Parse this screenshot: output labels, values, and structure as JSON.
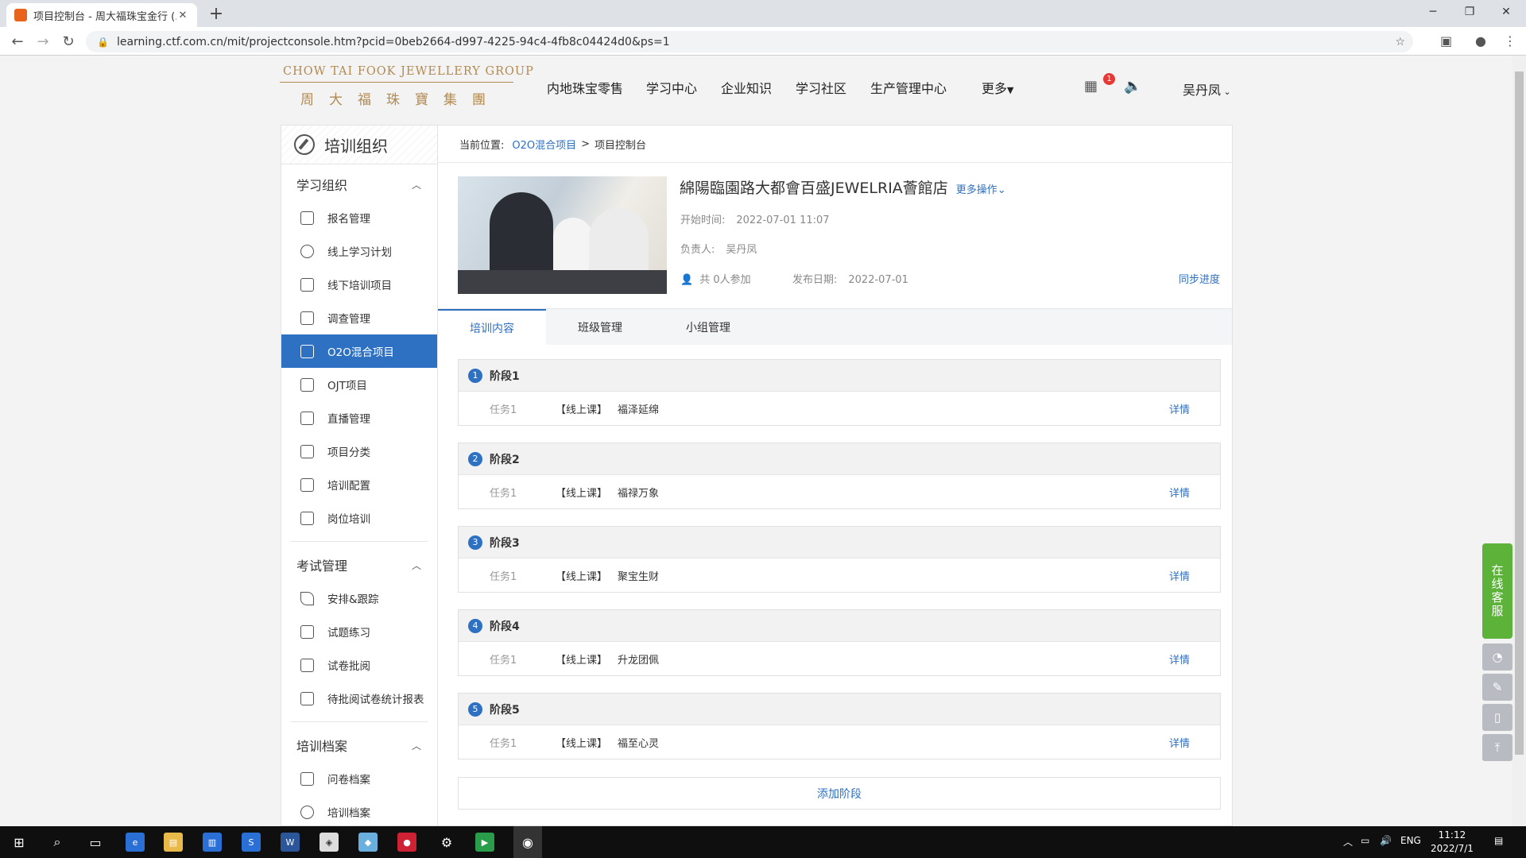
{
  "browser": {
    "tab_title": "项目控制台 - 周大福珠宝金行 (...",
    "url": "learning.ctf.com.cn/mit/projectconsole.htm?pcid=0beb2664-d997-4225-94c4-4fb8c04424d0&ps=1"
  },
  "site": {
    "logo_en": "CHOW TAI FOOK JEWELLERY GROUP",
    "logo_cn": "周大福珠寶集團",
    "nav": [
      "内地珠宝零售",
      "学习中心",
      "企业知识",
      "学习社区",
      "生产管理中心",
      "更多"
    ],
    "notification_count": "1",
    "user": "吴丹凤"
  },
  "sidebar": {
    "title": "培训组织",
    "groups": [
      {
        "label": "学习组织",
        "items": [
          "报名管理",
          "线上学习计划",
          "线下培训项目",
          "调查管理",
          "O2O混合项目",
          "OJT项目",
          "直播管理",
          "项目分类",
          "培训配置",
          "岗位培训"
        ]
      },
      {
        "label": "考试管理",
        "items": [
          "安排&跟踪",
          "试题练习",
          "试卷批阅",
          "待批阅试卷统计报表"
        ]
      },
      {
        "label": "培训档案",
        "items": [
          "问卷档案",
          "培训档案"
        ]
      }
    ],
    "active_item": "O2O混合项目"
  },
  "breadcrumb": {
    "label": "当前位置:",
    "link": "O2O混合项目",
    "separator": ">",
    "current": "项目控制台"
  },
  "project": {
    "title": "綿陽臨園路大都會百盛JEWELRIA薈館店",
    "more_actions": "更多操作",
    "start_label": "开始时间:",
    "start_value": "2022-07-01 11:07",
    "owner_label": "负责人:",
    "owner_value": "吴丹凤",
    "participants": "共 0人参加",
    "publish_label": "发布日期:",
    "publish_value": "2022-07-01",
    "sync_progress": "同步进度"
  },
  "tabs": [
    "培训内容",
    "班级管理",
    "小组管理"
  ],
  "active_tab": "培训内容",
  "stages": [
    {
      "num": "1",
      "title": "阶段1",
      "task": "任务1",
      "type": "【线上课】",
      "name": "福泽延绵",
      "detail": "详情"
    },
    {
      "num": "2",
      "title": "阶段2",
      "task": "任务1",
      "type": "【线上课】",
      "name": "福禄万象",
      "detail": "详情"
    },
    {
      "num": "3",
      "title": "阶段3",
      "task": "任务1",
      "type": "【线上课】",
      "name": "聚宝生财",
      "detail": "详情"
    },
    {
      "num": "4",
      "title": "阶段4",
      "task": "任务1",
      "type": "【线上课】",
      "name": "升龙团佩",
      "detail": "详情"
    },
    {
      "num": "5",
      "title": "阶段5",
      "task": "任务1",
      "type": "【线上课】",
      "name": "福至心灵",
      "detail": "详情"
    }
  ],
  "add_stage": "添加阶段",
  "floating": {
    "online_service": "在线客服"
  },
  "taskbar": {
    "lang": "ENG",
    "time": "11:12",
    "date": "2022/7/1"
  },
  "colors": {
    "accent": "#2e70c2",
    "brand_gold": "#b38a4f",
    "service_green": "#5db33a"
  }
}
